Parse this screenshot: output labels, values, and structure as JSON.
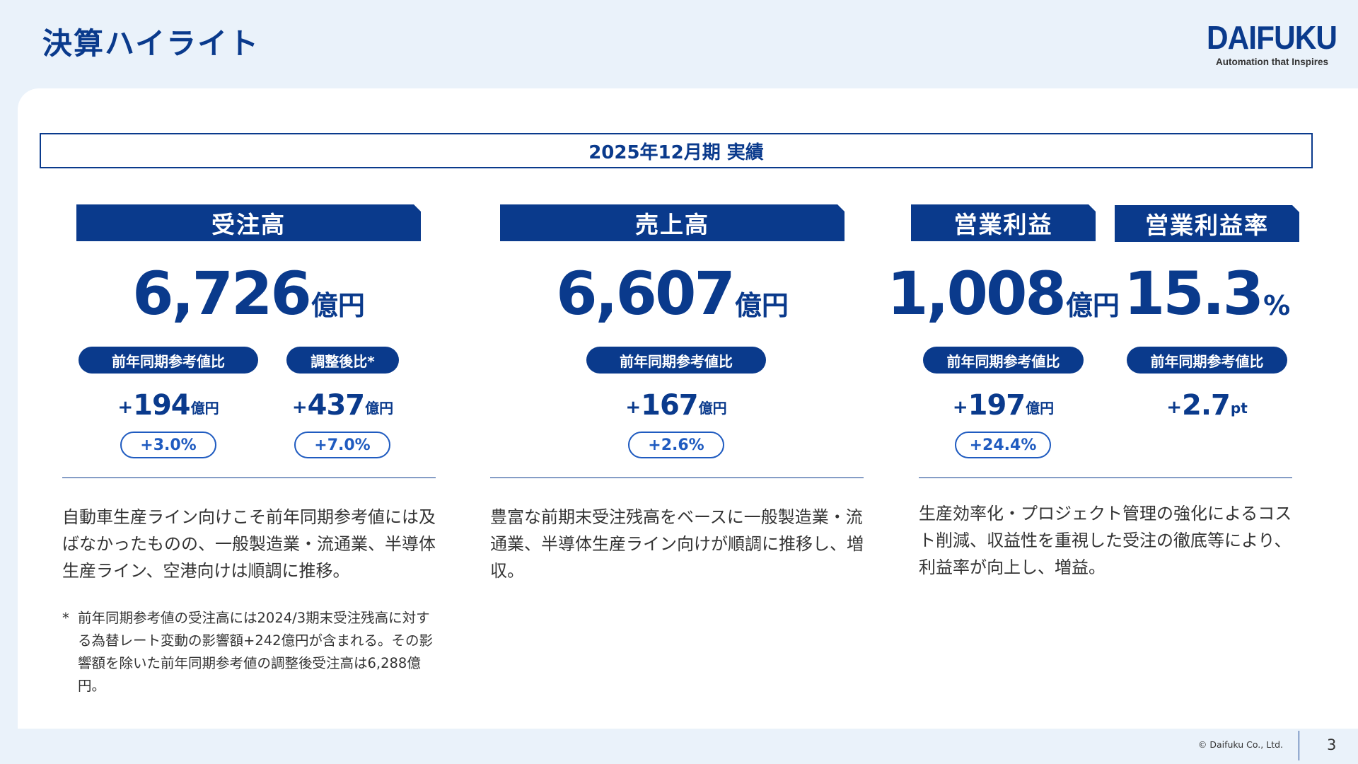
{
  "header": {
    "title": "決算ハイライト",
    "logo_text": "DAIFUKU",
    "logo_tagline": "Automation that Inspires"
  },
  "period": "2025年12月期 実績",
  "orders": {
    "label": "受注高",
    "value": "6,726",
    "unit": "億円",
    "comparisons": [
      {
        "pill": "前年同期参考値比",
        "sign": "+",
        "delta": "194",
        "delta_unit": "億円",
        "pct": "+3.0%"
      },
      {
        "pill": "調整後比*",
        "sign": "+",
        "delta": "437",
        "delta_unit": "億円",
        "pct": "+7.0%"
      }
    ],
    "description": "自動車生産ライン向けこそ前年同期参考値には及ばなかったものの、一般製造業・流通業、半導体生産ライン、空港向けは順調に推移。",
    "note_mark": "*",
    "note": "前年同期参考値の受注高には2024/3期末受注残高に対する為替レート変動の影響額+242億円が含まれる。その影響額を除いた前年同期参考値の調整後受注高は6,288億円。"
  },
  "sales": {
    "label": "売上高",
    "value": "6,607",
    "unit": "億円",
    "pill": "前年同期参考値比",
    "sign": "+",
    "delta": "167",
    "delta_unit": "億円",
    "pct": "+2.6%",
    "description": "豊富な前期末受注残高をベースに一般製造業・流通業、半導体生産ライン向けが順調に推移し、増収。"
  },
  "operating_income": {
    "label": "営業利益",
    "value": "1,008",
    "unit": "億円",
    "pill": "前年同期参考値比",
    "sign": "+",
    "delta": "197",
    "delta_unit": "億円",
    "pct": "+24.4%"
  },
  "operating_margin": {
    "label": "営業利益率",
    "value": "15.3",
    "unit": "%",
    "pill": "前年同期参考値比",
    "sign": "+",
    "delta": "2.7",
    "delta_unit": "pt"
  },
  "profit_description": "生産効率化・プロジェクト管理の強化によるコスト削減、収益性を重視した受注の徹底等により、利益率が向上し、増益。",
  "footer": {
    "copyright": "© Daifuku Co., Ltd.",
    "page": "3"
  }
}
